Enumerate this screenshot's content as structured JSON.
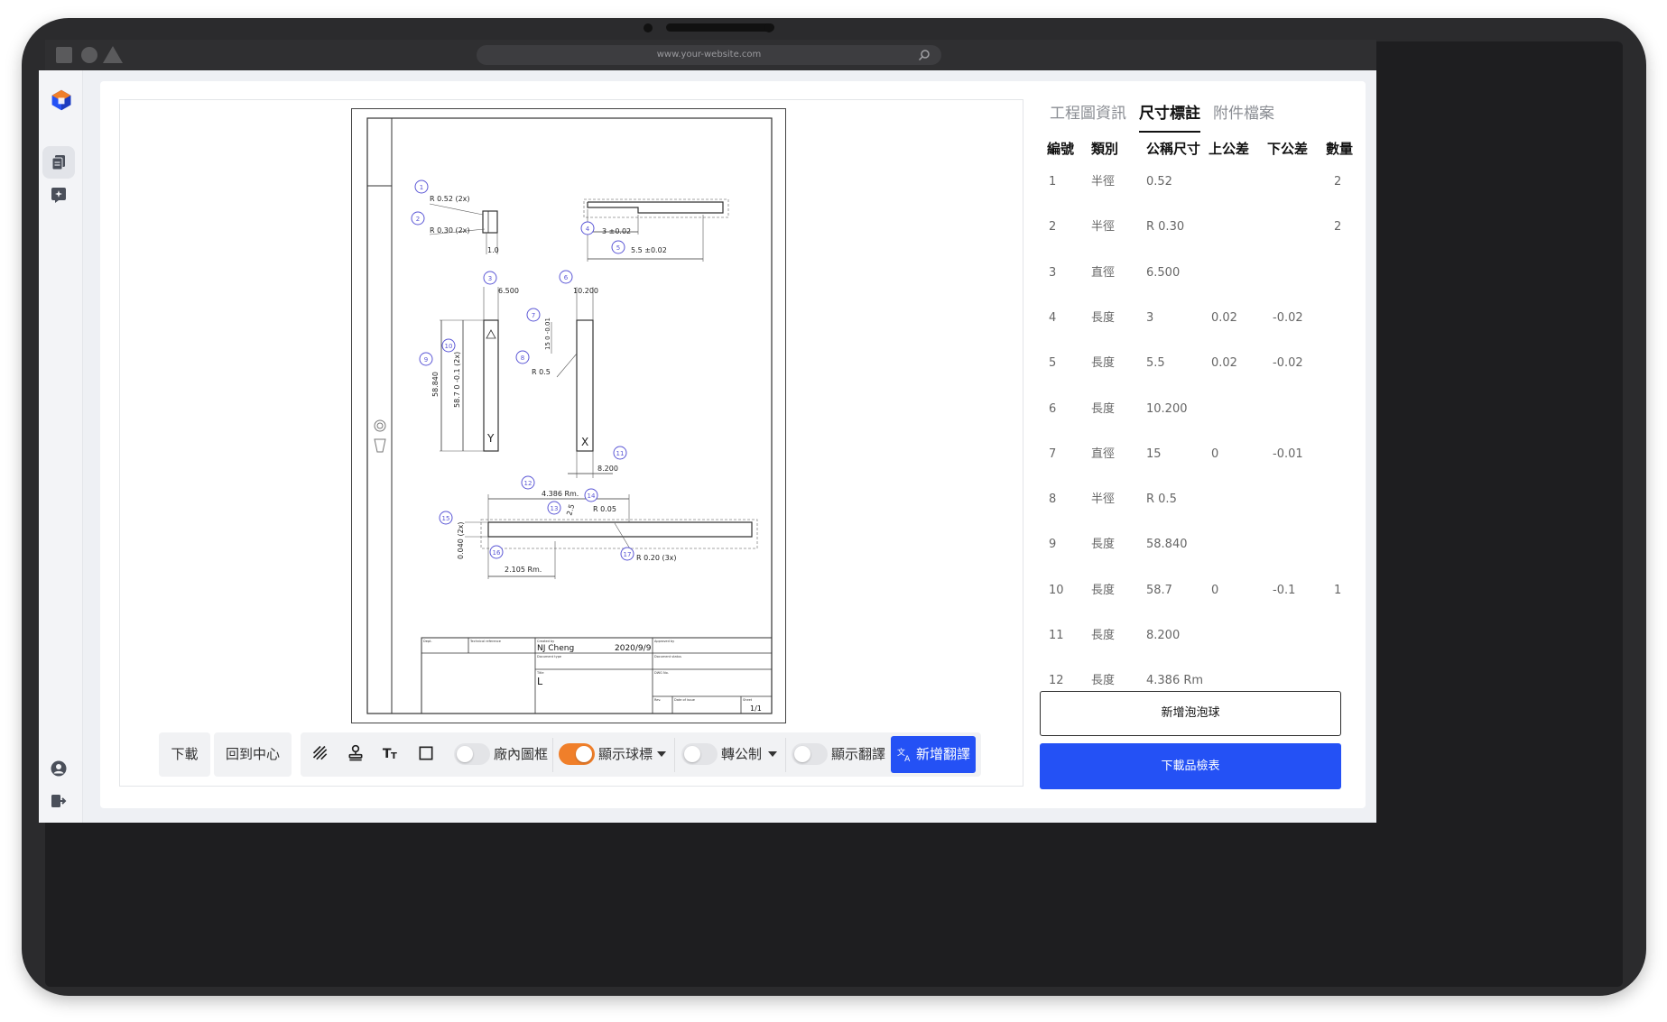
{
  "browser": {
    "url": "www.your-website.com"
  },
  "toolbar": {
    "download_label": "下載",
    "recenter_label": "回到中心",
    "factory_frame_label": "廠內圖框",
    "factory_frame_on": false,
    "show_balloons_label": "顯示球標",
    "show_balloons_on": true,
    "metric_label": "轉公制",
    "metric_on": false,
    "show_translation_label": "顯示翻譯",
    "show_translation_on": false,
    "add_translation_label": "新增翻譯"
  },
  "tabs": [
    {
      "label": "工程圖資訊",
      "active": false
    },
    {
      "label": "尺寸標註",
      "active": true
    },
    {
      "label": "附件檔案",
      "active": false
    }
  ],
  "table": {
    "headers": [
      "編號",
      "類別",
      "公稱尺寸",
      "上公差",
      "下公差",
      "數量"
    ],
    "rows": [
      {
        "no": "1",
        "type": "半徑",
        "nominal": "0.52",
        "upper": "",
        "lower": "",
        "qty": "2"
      },
      {
        "no": "2",
        "type": "半徑",
        "nominal": "R 0.30",
        "upper": "",
        "lower": "",
        "qty": "2"
      },
      {
        "no": "3",
        "type": "直徑",
        "nominal": "6.500",
        "upper": "",
        "lower": "",
        "qty": ""
      },
      {
        "no": "4",
        "type": "長度",
        "nominal": "3",
        "upper": "0.02",
        "lower": "-0.02",
        "qty": ""
      },
      {
        "no": "5",
        "type": "長度",
        "nominal": "5.5",
        "upper": "0.02",
        "lower": "-0.02",
        "qty": ""
      },
      {
        "no": "6",
        "type": "長度",
        "nominal": "10.200",
        "upper": "",
        "lower": "",
        "qty": ""
      },
      {
        "no": "7",
        "type": "直徑",
        "nominal": "15",
        "upper": "0",
        "lower": "-0.01",
        "qty": ""
      },
      {
        "no": "8",
        "type": "半徑",
        "nominal": "R 0.5",
        "upper": "",
        "lower": "",
        "qty": ""
      },
      {
        "no": "9",
        "type": "長度",
        "nominal": "58.840",
        "upper": "",
        "lower": "",
        "qty": ""
      },
      {
        "no": "10",
        "type": "長度",
        "nominal": "58.7",
        "upper": "0",
        "lower": "-0.1",
        "qty": "1"
      },
      {
        "no": "11",
        "type": "長度",
        "nominal": "8.200",
        "upper": "",
        "lower": "",
        "qty": ""
      },
      {
        "no": "12",
        "type": "長度",
        "nominal": "4.386 Rm",
        "upper": "",
        "lower": "",
        "qty": ""
      }
    ]
  },
  "actions": {
    "add_balloon_label": "新增泡泡球",
    "download_report_label": "下載品檢表"
  },
  "drawing": {
    "balloons": [
      "1",
      "2",
      "3",
      "4",
      "5",
      "6",
      "7",
      "8",
      "9",
      "10",
      "11",
      "12",
      "13",
      "14",
      "15",
      "16",
      "17"
    ],
    "dims": {
      "d1": "R 0.52 (2x)",
      "d2": "R 0.30 (2x)",
      "d_1_0": "1.0",
      "d3": "6.500",
      "d4": "3 ±0.02",
      "d5": "5.5 ±0.02",
      "d6": "10.200",
      "d7": "15 0 -0.01",
      "d8": "R 0.5",
      "d9": "58.840",
      "d10": "58.7 0 -0.1 (2x)",
      "d11": "8.200",
      "d12": "4.386 Rm.",
      "d13": "2.5",
      "d14": "R 0.05",
      "d15": "0.040 (2x)",
      "d16": "2.105 Rm.",
      "d17": "R 0.20 (3x)",
      "label_y": "Y",
      "label_x": "X"
    },
    "title_block": {
      "dept": "Dept.",
      "tech_ref": "Technical reference",
      "created_by_label": "Created by",
      "created_by": "NJ Cheng",
      "date": "2020/9/9",
      "approved_by_label": "Approved by",
      "doc_type_label": "Document type",
      "doc_status_label": "Document status",
      "title_label": "Title",
      "title": "L",
      "dwg_label": "DWG No.",
      "rev_label": "Rev.",
      "date_issue_label": "Date of issue",
      "sheet_label": "Sheet",
      "sheet": "1/1"
    }
  },
  "colors": {
    "accent": "#2451f5",
    "toggle_on": "#f07f2a",
    "balloon": "#5b57d6"
  }
}
